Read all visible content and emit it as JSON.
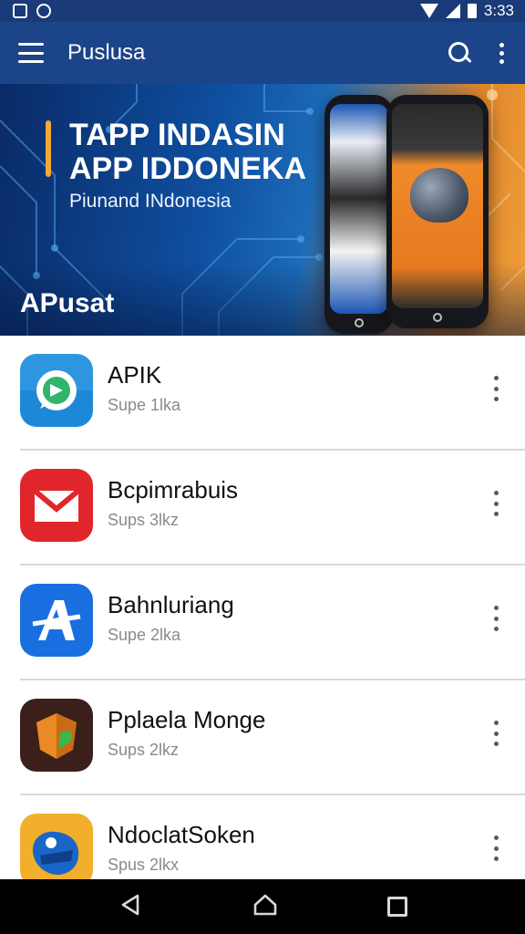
{
  "status_bar": {
    "time": "3:33"
  },
  "app_bar": {
    "title": "Puslusa"
  },
  "banner": {
    "headline_1": "TAPP INDASIN",
    "headline_2": "APP IDDONEKA",
    "subtitle": "Piunand INdonesia",
    "section_label": "APusat"
  },
  "apps": [
    {
      "name": "APIK",
      "subtitle": "Supe 1lka",
      "icon": "whatsapp-like-icon",
      "icon_color": "#1e88d8"
    },
    {
      "name": "Bcpimrabuis",
      "subtitle": "Sups 3lkz",
      "icon": "mail-envelope-icon",
      "icon_color": "#e0262a"
    },
    {
      "name": "Bahnluriang",
      "subtitle": "Supe 2lka",
      "icon": "letter-a-icon",
      "icon_color": "#1a6fe0"
    },
    {
      "name": "Pplaela Monge",
      "subtitle": "Sups 2lkz",
      "icon": "orange-shield-icon",
      "icon_color": "#3a1f1a"
    },
    {
      "name": "NdoclatSoken",
      "subtitle": "Spus 2lkx",
      "icon": "blue-badge-icon",
      "icon_color": "#f0a21e"
    }
  ],
  "colors": {
    "app_bar": "#1c4488",
    "status_bar": "#1a3a78",
    "accent": "#f2a93a"
  }
}
